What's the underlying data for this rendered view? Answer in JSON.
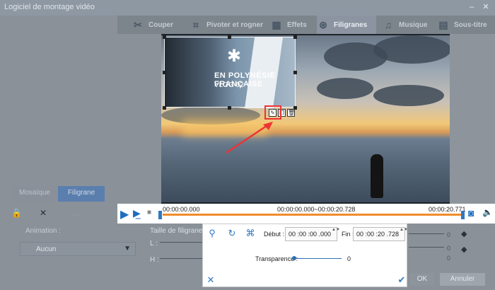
{
  "window": {
    "title": "Logiciel de montage vidéo",
    "minimize": "–",
    "maximize": "□",
    "close": "✕"
  },
  "toolbar": {
    "tabs": [
      {
        "label": "Couper",
        "icon": "scissors-icon"
      },
      {
        "label": "Pivoter et rogner",
        "icon": "crop-icon"
      },
      {
        "label": "Effets",
        "icon": "film-effects-icon"
      },
      {
        "label": "Filigranes",
        "icon": "film-reel-icon",
        "active": true
      },
      {
        "label": "Musique",
        "icon": "music-note-icon"
      },
      {
        "label": "Sous-titre",
        "icon": "subtitle-icon"
      }
    ]
  },
  "watermark_image": {
    "line1": "EN POLYNÉSIE FRANÇAISE",
    "line2": "VLOG 02"
  },
  "player": {
    "time_start": "00:00:00.000",
    "time_range": "00:00:00.000~00:00:20.728",
    "time_end": "00:00:20.771"
  },
  "left_tabs": {
    "tab1": "Mosaïque",
    "tab2": "Filigrane"
  },
  "left_panel": {
    "animation_label": "Animation :",
    "animation_value": "Aucun"
  },
  "size": {
    "title": "Taille de filigrane :",
    "w_label": "L :",
    "h_label": "H :"
  },
  "edit_panel": {
    "start_label": "Début :",
    "start_value": "00 :00 :00 .000",
    "end_label": "Fin :",
    "end_value": "00 :00 :20 .728",
    "transparency_label": "Transparence :",
    "transparency_value": "0"
  },
  "right_values": {
    "v1": "0",
    "v2": "0",
    "v3": "0",
    "v4": "0"
  },
  "footer": {
    "ok": "OK",
    "cancel": "Annuler"
  },
  "colors": {
    "accent": "#2f79c2",
    "timeline": "#f08c2a",
    "highlight": "#e33333"
  }
}
